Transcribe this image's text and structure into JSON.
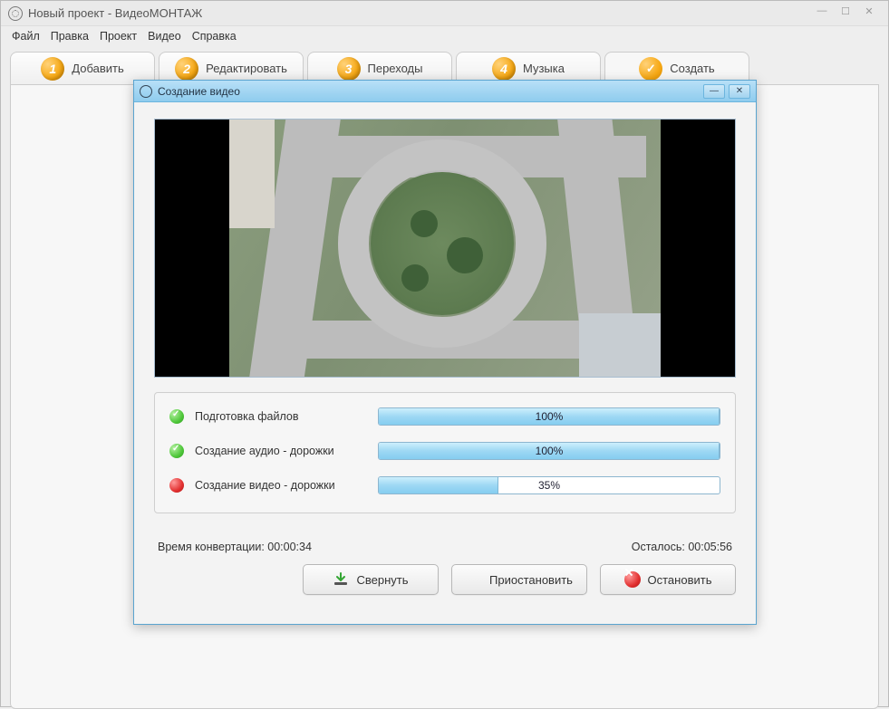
{
  "main_window": {
    "title": "Новый проект - ВидеоМОНТАЖ",
    "menu": [
      "Файл",
      "Правка",
      "Проект",
      "Видео",
      "Справка"
    ],
    "tabs": [
      {
        "num": "1",
        "label": "Добавить"
      },
      {
        "num": "2",
        "label": "Редактировать"
      },
      {
        "num": "3",
        "label": "Переходы"
      },
      {
        "num": "4",
        "label": "Музыка"
      },
      {
        "num": "✓",
        "label": "Создать"
      }
    ]
  },
  "dialog": {
    "title": "Создание видео",
    "progress": [
      {
        "label": "Подготовка файлов",
        "percent": 100,
        "status": "ok"
      },
      {
        "label": "Создание аудио - дорожки",
        "percent": 100,
        "status": "ok"
      },
      {
        "label": "Создание видео - дорожки",
        "percent": 35,
        "status": "active"
      }
    ],
    "time_elapsed_label": "Время конвертации: ",
    "time_elapsed": "00:00:34",
    "time_remaining_label": "Осталось: ",
    "time_remaining": "00:05:56",
    "buttons": {
      "minimize": "Свернуть",
      "pause": "Приостановить",
      "stop": "Остановить"
    }
  }
}
